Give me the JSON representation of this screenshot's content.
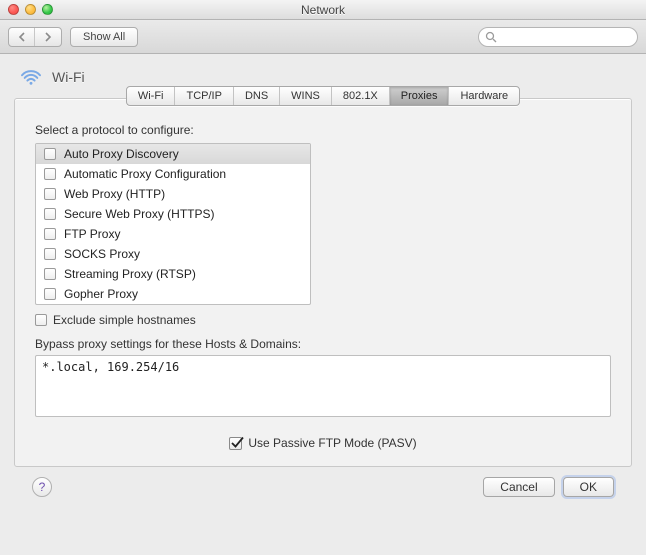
{
  "window": {
    "title": "Network"
  },
  "toolbar": {
    "show_all": "Show All",
    "search_placeholder": ""
  },
  "section": {
    "name": "Wi-Fi"
  },
  "tabs": [
    {
      "id": "wifi",
      "label": "Wi-Fi",
      "active": false
    },
    {
      "id": "tcpip",
      "label": "TCP/IP",
      "active": false
    },
    {
      "id": "dns",
      "label": "DNS",
      "active": false
    },
    {
      "id": "wins",
      "label": "WINS",
      "active": false
    },
    {
      "id": "8021x",
      "label": "802.1X",
      "active": false
    },
    {
      "id": "proxies",
      "label": "Proxies",
      "active": true
    },
    {
      "id": "hardware",
      "label": "Hardware",
      "active": false
    }
  ],
  "proxies": {
    "select_prompt": "Select a protocol to configure:",
    "protocols": [
      {
        "label": "Auto Proxy Discovery",
        "checked": false,
        "selected": true
      },
      {
        "label": "Automatic Proxy Configuration",
        "checked": false,
        "selected": false
      },
      {
        "label": "Web Proxy (HTTP)",
        "checked": false,
        "selected": false
      },
      {
        "label": "Secure Web Proxy (HTTPS)",
        "checked": false,
        "selected": false
      },
      {
        "label": "FTP Proxy",
        "checked": false,
        "selected": false
      },
      {
        "label": "SOCKS Proxy",
        "checked": false,
        "selected": false
      },
      {
        "label": "Streaming Proxy (RTSP)",
        "checked": false,
        "selected": false
      },
      {
        "label": "Gopher Proxy",
        "checked": false,
        "selected": false
      }
    ],
    "exclude_simple_label": "Exclude simple hostnames",
    "exclude_simple_checked": false,
    "bypass_label": "Bypass proxy settings for these Hosts & Domains:",
    "bypass_value": "*.local, 169.254/16",
    "passive_ftp_label": "Use Passive FTP Mode (PASV)",
    "passive_ftp_checked": true
  },
  "footer": {
    "cancel": "Cancel",
    "ok": "OK",
    "help": "?"
  }
}
